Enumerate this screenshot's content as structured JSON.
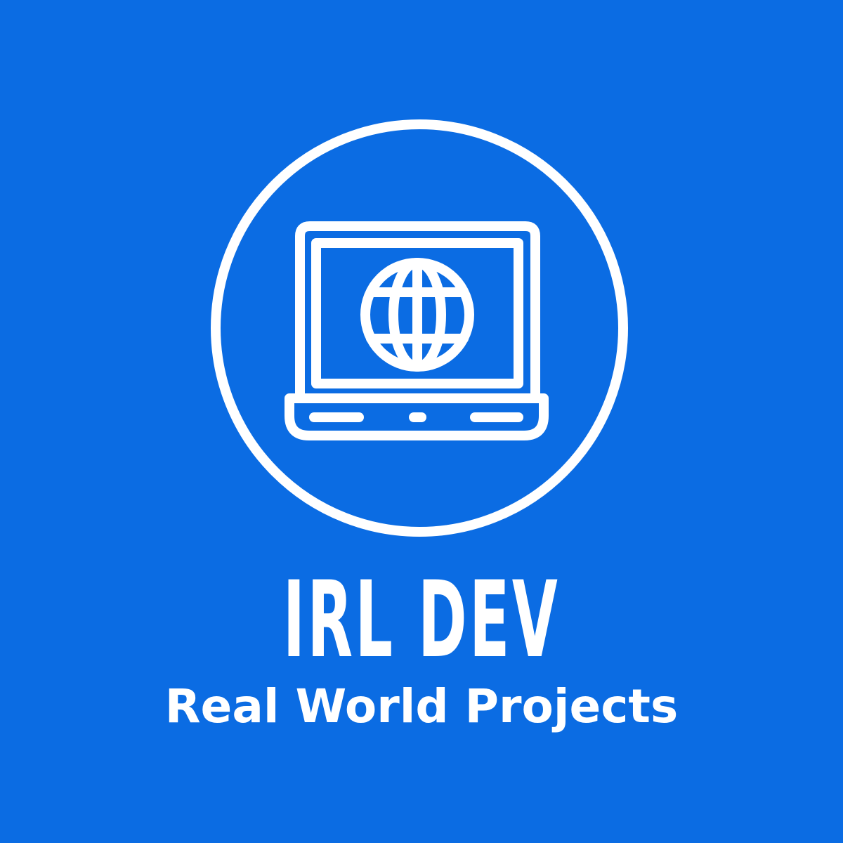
{
  "colors": {
    "background": "#0b6ce3",
    "foreground": "#ffffff"
  },
  "emblem": {
    "icon": "laptop-globe-icon"
  },
  "title": "IRL DEV",
  "tagline": "Real World Projects"
}
